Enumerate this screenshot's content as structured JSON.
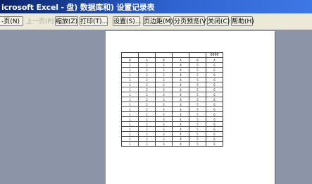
{
  "window": {
    "title": "icrosoft Excel - 盘) 数据库和) 设置记录表"
  },
  "toolbar": {
    "buttons": [
      {
        "label": "-页(N)",
        "enabled": true
      },
      {
        "label": "上一页(P)",
        "enabled": false
      },
      {
        "label": "缩放(Z)",
        "enabled": true
      },
      {
        "label": "打印(T)...",
        "enabled": true
      },
      {
        "label": "设置(S)...",
        "enabled": true
      },
      {
        "label": "页边距(M)",
        "enabled": true
      },
      {
        "label": "分页预览(V)",
        "enabled": true
      },
      {
        "label": "关闭(C)",
        "enabled": true
      },
      {
        "label": "帮助(H)",
        "enabled": true
      }
    ]
  },
  "sheet": {
    "header_value": "0000",
    "rows": [
      [
        "B",
        "A",
        "B",
        "A",
        "B",
        "A"
      ],
      [
        "1",
        "2",
        "3",
        "4",
        "5",
        "6"
      ],
      [
        "1",
        "2",
        "3",
        "4",
        "5",
        "6"
      ],
      [
        "1",
        "2",
        "3",
        "4",
        "5",
        "6"
      ],
      [
        "1",
        "2",
        "3",
        "4",
        "5",
        "6"
      ],
      [
        "1",
        "2",
        "3",
        "4",
        "5",
        "6"
      ],
      [
        "1",
        "2",
        "3",
        "4",
        "5",
        "6"
      ],
      [
        "1",
        "2",
        "3",
        "4",
        "5",
        "6"
      ],
      [
        "1",
        "2",
        "3",
        "4",
        "5",
        "6"
      ],
      [
        "1",
        "2",
        "3",
        "4",
        "5",
        "6"
      ],
      [
        "1",
        "2",
        "3",
        "4",
        "5",
        "6"
      ],
      [
        "1",
        "2",
        "3",
        "4",
        "5",
        "6"
      ],
      [
        "1",
        "2",
        "3",
        "4",
        "5",
        "6"
      ],
      [
        "1",
        "2",
        "3",
        "4",
        "5",
        "6"
      ],
      [
        "1",
        "2",
        "3",
        "4",
        "5",
        "6"
      ],
      [
        "1",
        "2",
        "3",
        "4",
        "5",
        "6"
      ],
      [
        "1",
        "2",
        "3",
        "4",
        "5",
        "6"
      ],
      [
        "1",
        "2",
        "3",
        "4",
        "5",
        "6"
      ]
    ]
  }
}
